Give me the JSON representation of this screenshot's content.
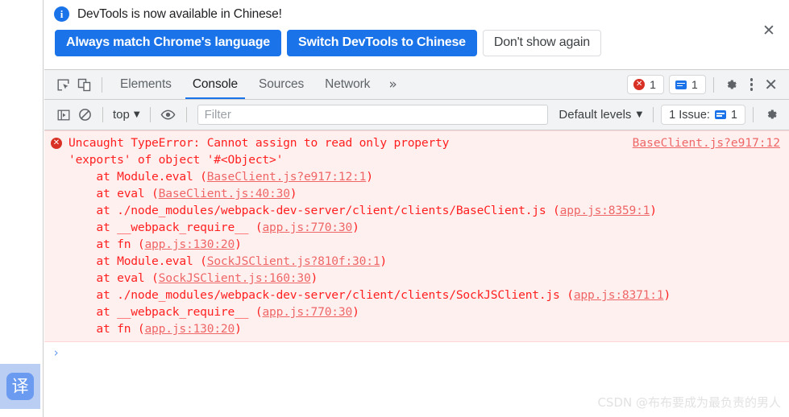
{
  "banner": {
    "info_icon": "info-icon",
    "message": "DevTools is now available in Chinese!",
    "primary_button": "Always match Chrome's language",
    "secondary_button": "Switch DevTools to Chinese",
    "dismiss_button": "Don't show again",
    "close_icon": "✕"
  },
  "tabstrip": {
    "inspect_icon": "inspect-element-icon",
    "device_icon": "device-toolbar-icon",
    "tabs": [
      {
        "label": "Elements",
        "active": false
      },
      {
        "label": "Console",
        "active": true
      },
      {
        "label": "Sources",
        "active": false
      },
      {
        "label": "Network",
        "active": false
      }
    ],
    "more_tabs_icon": "»",
    "error_count": "1",
    "message_count": "1",
    "settings_icon": "gear-icon",
    "menu_icon": "kebab-menu-icon",
    "close_icon": "✕"
  },
  "filterbar": {
    "sidebar_icon": "console-sidebar-icon",
    "clear_icon": "clear-console-icon",
    "context": "top",
    "caret": "▼",
    "eye_icon": "live-expression-icon",
    "filter_placeholder": "Filter",
    "filter_value": "",
    "levels": "Default levels",
    "levels_caret": "▼",
    "issues_label": "1 Issue:",
    "issues_count": "1",
    "settings_icon": "console-settings-icon"
  },
  "console": {
    "error_icon": "error-circle-icon",
    "source_link": "BaseClient.js?e917:12",
    "message": "Uncaught TypeError: Cannot assign to read only property\n'exports' of object '#<Object>'",
    "stack": [
      {
        "text": "    at Module.eval (",
        "link": "BaseClient.js?e917:12:1",
        "tail": ")"
      },
      {
        "text": "    at eval (",
        "link": "BaseClient.js:40:30",
        "tail": ")"
      },
      {
        "text": "    at ./node_modules/webpack-dev-server/client/clients/BaseClient.js (",
        "link": "app.js:8359:1",
        "tail": ")"
      },
      {
        "text": "    at __webpack_require__ (",
        "link": "app.js:770:30",
        "tail": ")"
      },
      {
        "text": "    at fn (",
        "link": "app.js:130:20",
        "tail": ")"
      },
      {
        "text": "    at Module.eval (",
        "link": "SockJSClient.js?810f:30:1",
        "tail": ")"
      },
      {
        "text": "    at eval (",
        "link": "SockJSClient.js:160:30",
        "tail": ")"
      },
      {
        "text": "    at ./node_modules/webpack-dev-server/client/clients/SockJSClient.js (",
        "link": "app.js:8371:1",
        "tail": ")"
      },
      {
        "text": "    at __webpack_require__ (",
        "link": "app.js:770:30",
        "tail": ")"
      },
      {
        "text": "    at fn (",
        "link": "app.js:130:20",
        "tail": ")"
      }
    ],
    "prompt_caret": "›"
  },
  "translate_widget": {
    "label": "译"
  },
  "watermark": "CSDN @布布要成为最负责的男人",
  "colors": {
    "accent": "#1a73e8",
    "error": "#d93025",
    "error_text": "#ff2020",
    "error_bg": "#fff0f0"
  }
}
